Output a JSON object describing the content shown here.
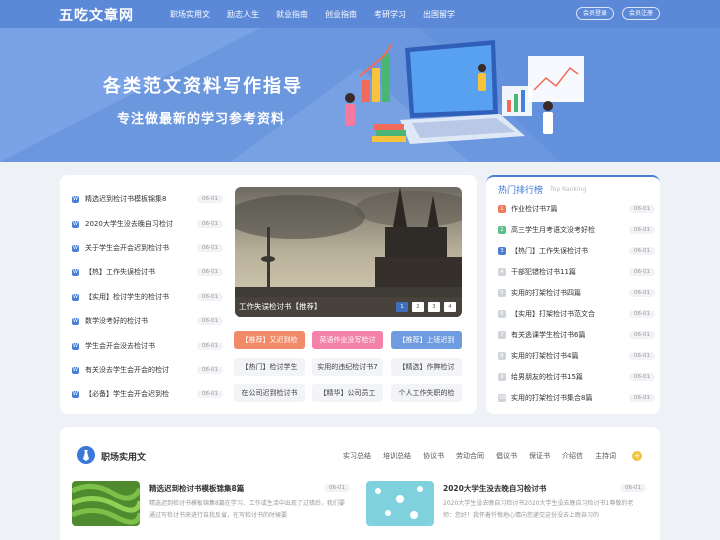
{
  "header": {
    "logo": "五吃文章网",
    "nav": [
      "职场实用文",
      "励志人生",
      "就业指南",
      "创业指南",
      "考研学习",
      "出国留学"
    ],
    "login": "会员登录",
    "register": "会员注册"
  },
  "banner": {
    "title": "各类范文资料写作指导",
    "subtitle": "专注做最新的学习参考资料"
  },
  "latest": {
    "items": [
      {
        "title": "精选迟到检讨书模板锦集8",
        "date": "06-01"
      },
      {
        "title": "2020大学生没去晚自习检讨",
        "date": "06-01"
      },
      {
        "title": "关于学生会开会迟到检讨书",
        "date": "06-01"
      },
      {
        "title": "【热】工作失误检讨书",
        "date": "06-01"
      },
      {
        "title": "【实用】检讨学生的检讨书",
        "date": "06-01"
      },
      {
        "title": "数学没考好的检讨书",
        "date": "06-01"
      },
      {
        "title": "学生会开会没去检讨书",
        "date": "06-01"
      },
      {
        "title": "有关没去学生会开会的检讨",
        "date": "06-01"
      },
      {
        "title": "【必备】学生会开会迟到检",
        "date": "06-01"
      }
    ]
  },
  "slideshow": {
    "caption": "工作失误检讨书【推荐】",
    "pages": [
      "1",
      "2",
      "3",
      "4"
    ],
    "active": 1
  },
  "tags": [
    "【推荐】又迟到检",
    "英语作业没写检讨",
    "【推荐】上班迟到",
    "【热门】检讨学生",
    "实用的违纪检讨书7",
    "【精选】作弊检讨",
    "在公司迟到检讨书",
    "【精华】公司员工",
    "个人工作失职的检"
  ],
  "hot": {
    "title": "热门排行榜",
    "subtitle": "Top Ranking",
    "items": [
      {
        "rank": "1",
        "title": "作业检讨书7篇",
        "date": "06-01"
      },
      {
        "rank": "2",
        "title": "高三学生月考语文没考好检",
        "date": "06-01"
      },
      {
        "rank": "3",
        "title": "【热门】工作失误检讨书",
        "date": "06-01"
      },
      {
        "rank": "4",
        "title": "干部犯错检讨书11篇",
        "date": "06-01"
      },
      {
        "rank": "5",
        "title": "实用的打架检讨书四篇",
        "date": "06-01"
      },
      {
        "rank": "6",
        "title": "【实用】打架检讨书范文合",
        "date": "06-01"
      },
      {
        "rank": "7",
        "title": "有关逃课学生检讨书6篇",
        "date": "06-01"
      },
      {
        "rank": "8",
        "title": "实用的打架检讨书4篇",
        "date": "06-01"
      },
      {
        "rank": "9",
        "title": "给男朋友的检讨书15篇",
        "date": "06-01"
      },
      {
        "rank": "10",
        "title": "实用的打架检讨书集合8篇",
        "date": "06-01"
      }
    ],
    "colors": [
      "#f07a5c",
      "#5cbf8a",
      "#4a7fd6",
      "#cfd3da"
    ]
  },
  "section": {
    "title": "职场实用文",
    "tabs": [
      "实习总结",
      "培训总结",
      "协议书",
      "劳动合同",
      "倡议书",
      "保证书",
      "介绍信",
      "主持词"
    ],
    "articles": [
      {
        "title": "精选迟到检讨书模板锦集8篇",
        "date": "06-01",
        "desc": "精选迟到检讨书模板锦集8篇在学习、工作或生活中出现了过错后，我们要通过写检讨书来进行自我反省，在写检讨书的时候要"
      },
      {
        "title": "2020大学生没去晚自习检讨书",
        "date": "06-01",
        "desc": "2020大学生没去晚自习检讨书2020大学生没去晚自习检讨书1尊敬的老师：您好！我怀着忏悔地心情向您递交这份没去上晚自习的"
      }
    ]
  }
}
